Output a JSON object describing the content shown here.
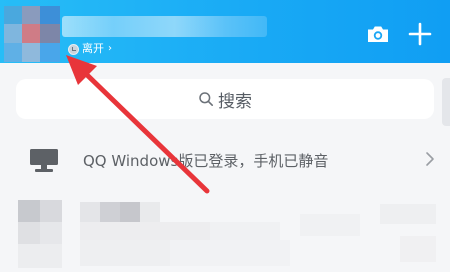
{
  "profile": {
    "status_label": "离开",
    "status_chevron": "›"
  },
  "header_actions": {
    "camera_icon": "camera-icon",
    "add_icon": "plus-icon"
  },
  "search": {
    "placeholder": "搜索",
    "icon": "search-icon"
  },
  "device_notice": {
    "text": "QQ Windows版已登录，手机已静音",
    "icon": "monitor-icon",
    "chevron": "chevron-right-icon"
  },
  "colors": {
    "header_start": "#27bdf7",
    "header_end": "#109ef3",
    "page_bg": "#f5f6f8",
    "annotation_arrow": "#e8353a"
  }
}
